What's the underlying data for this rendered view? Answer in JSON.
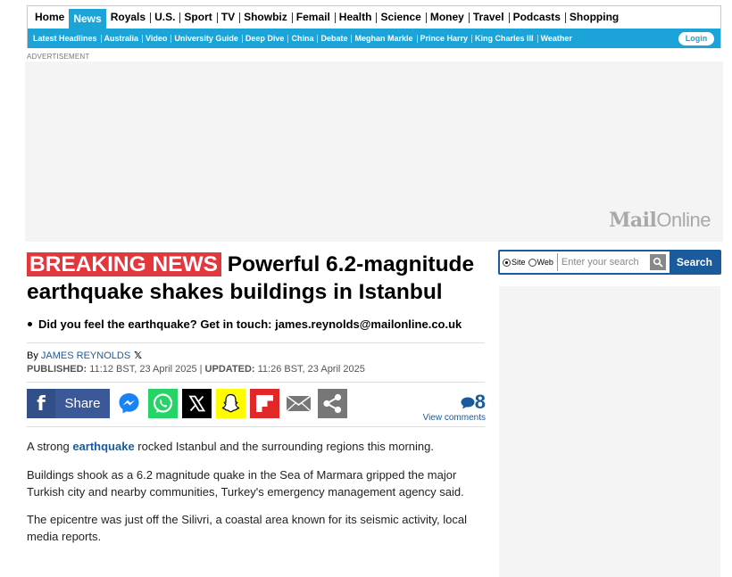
{
  "nav": {
    "primary": [
      "Home",
      "News",
      "Royals",
      "U.S.",
      "Sport",
      "TV",
      "Showbiz",
      "Femail",
      "Health",
      "Science",
      "Money",
      "Travel",
      "Podcasts",
      "Shopping"
    ],
    "active": "News",
    "secondary": [
      "Latest Headlines",
      "Australia",
      "Video",
      "University Guide",
      "Deep Dive",
      "China",
      "Debate",
      "Meghan Markle",
      "Prince Harry",
      "King Charles III",
      "Weather"
    ],
    "login": "Login"
  },
  "ads": {
    "label": "ADVERTISEMENT",
    "logo_bold": "Mail",
    "logo_light": "Online"
  },
  "article": {
    "breaking": "BREAKING NEWS",
    "headline": " Powerful 6.2-magnitude earthquake shakes buildings in Istanbul",
    "bullet": "Did you feel the earthquake? Get in touch: james.reynolds@mailonline.co.uk",
    "by": "By ",
    "author": "JAMES REYNOLDS",
    "published_label": "PUBLISHED:",
    "published": " 11:12 BST, 23 April 2025",
    "separator": " | ",
    "updated_label": "UPDATED:",
    "updated": " 11:26 BST, 23 April 2025",
    "share_label": "Share",
    "comment_count": "8",
    "view_comments": "View comments",
    "p1_pre": "A strong ",
    "p1_link": "earthquake",
    "p1_post": " rocked Istanbul and the surrounding regions this morning.",
    "p2": "Buildings shook as a 6.2 magnitude quake in the Sea of Marmara gripped the major Turkish city and nearby communities, Turkey's emergency management agency said.",
    "p3": "The epicentre was just off the Silivri, a coastal area known for its seismic activity, local media reports."
  },
  "search": {
    "site": "Site",
    "web": "Web",
    "placeholder": "Enter your search",
    "button": "Search"
  },
  "colors": {
    "accent": "#1ca4d9",
    "breaking": "#e1373d",
    "link": "#1a5b9b",
    "facebook": "#3b5998"
  }
}
